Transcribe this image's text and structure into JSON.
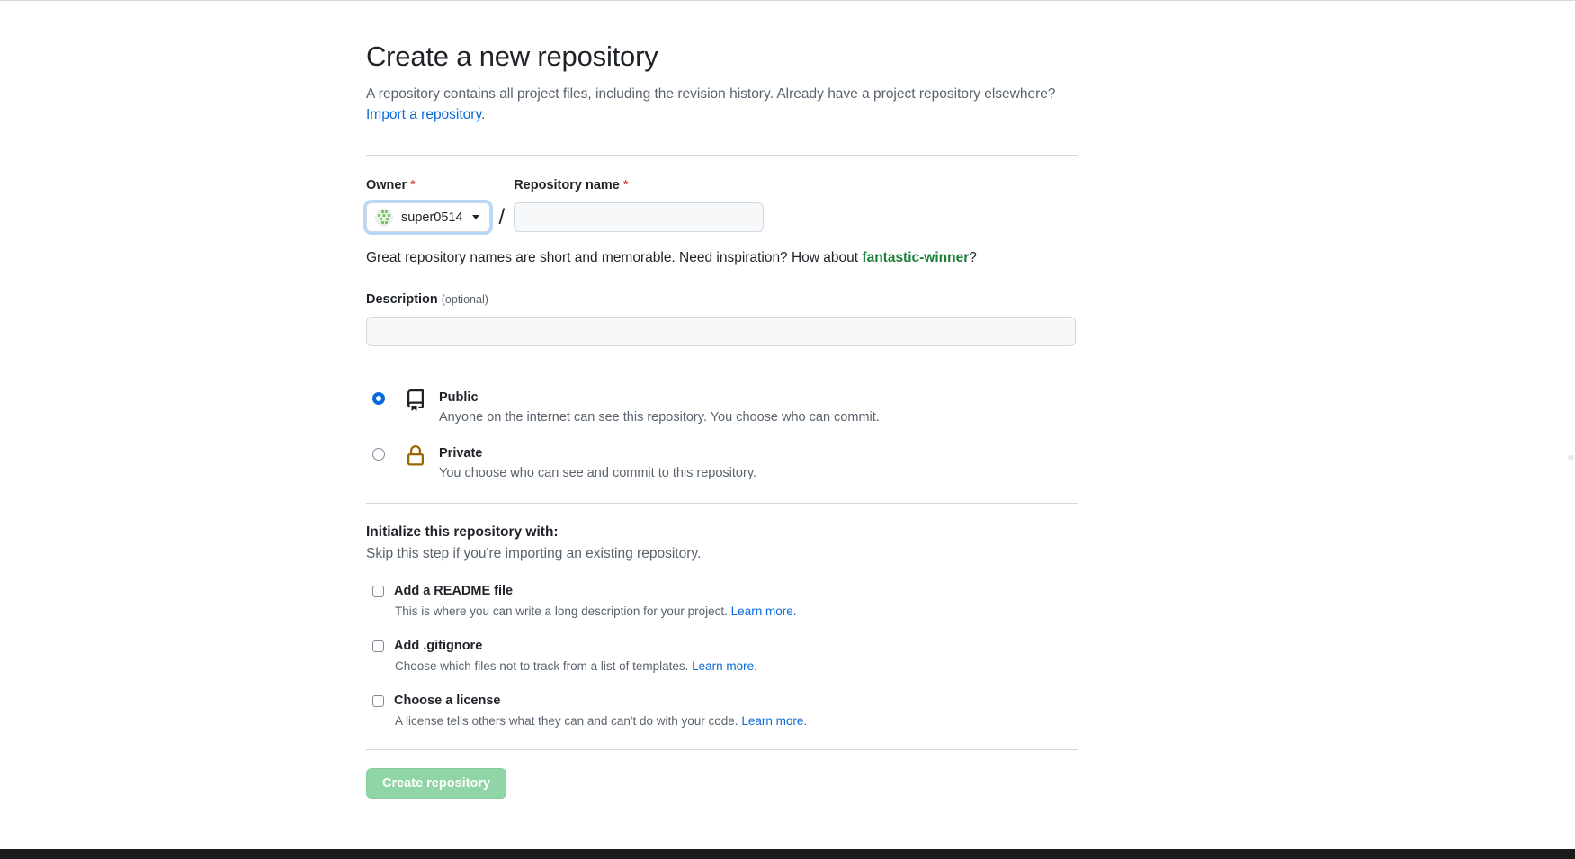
{
  "header": {
    "title": "Create a new repository",
    "subtitle_text": "A repository contains all project files, including the revision history. Already have a project repository elsewhere?",
    "import_link": "Import a repository."
  },
  "owner": {
    "label": "Owner",
    "required_marker": "*",
    "selected": "super0514",
    "separator": "/"
  },
  "repo_name": {
    "label": "Repository name",
    "required_marker": "*",
    "value": "",
    "placeholder": ""
  },
  "helper": {
    "prefix": "Great repository names are short and memorable. Need inspiration? How about ",
    "suggestion": "fantastic-winner",
    "suffix": "?"
  },
  "description": {
    "label": "Description",
    "optional_tag": "(optional)",
    "value": "",
    "placeholder": ""
  },
  "visibility": {
    "options": [
      {
        "id": "public",
        "title": "Public",
        "description": "Anyone on the internet can see this repository. You choose who can commit.",
        "icon": "repo-icon",
        "selected": true
      },
      {
        "id": "private",
        "title": "Private",
        "description": "You choose who can see and commit to this repository.",
        "icon": "lock-icon",
        "selected": false
      }
    ]
  },
  "initialize": {
    "heading": "Initialize this repository with:",
    "subheading": "Skip this step if you're importing an existing repository.",
    "options": [
      {
        "id": "readme",
        "label": "Add a README file",
        "description": "This is where you can write a long description for your project. ",
        "learn_more": "Learn more.",
        "checked": false
      },
      {
        "id": "gitignore",
        "label": "Add .gitignore",
        "description": "Choose which files not to track from a list of templates. ",
        "learn_more": "Learn more.",
        "checked": false
      },
      {
        "id": "license",
        "label": "Choose a license",
        "description": "A license tells others what they can and can't do with your code. ",
        "learn_more": "Learn more.",
        "checked": false
      }
    ]
  },
  "submit": {
    "label": "Create repository",
    "enabled": false
  },
  "colors": {
    "accent_link": "#0969da",
    "suggestion_green": "#1a7f37",
    "required_red": "#cf222e",
    "lock_gold": "#9a6700",
    "button_green_muted": "#8fd5a6",
    "muted_text": "#59636e",
    "border": "#d1d9e0",
    "input_bg": "#f6f8fa"
  }
}
